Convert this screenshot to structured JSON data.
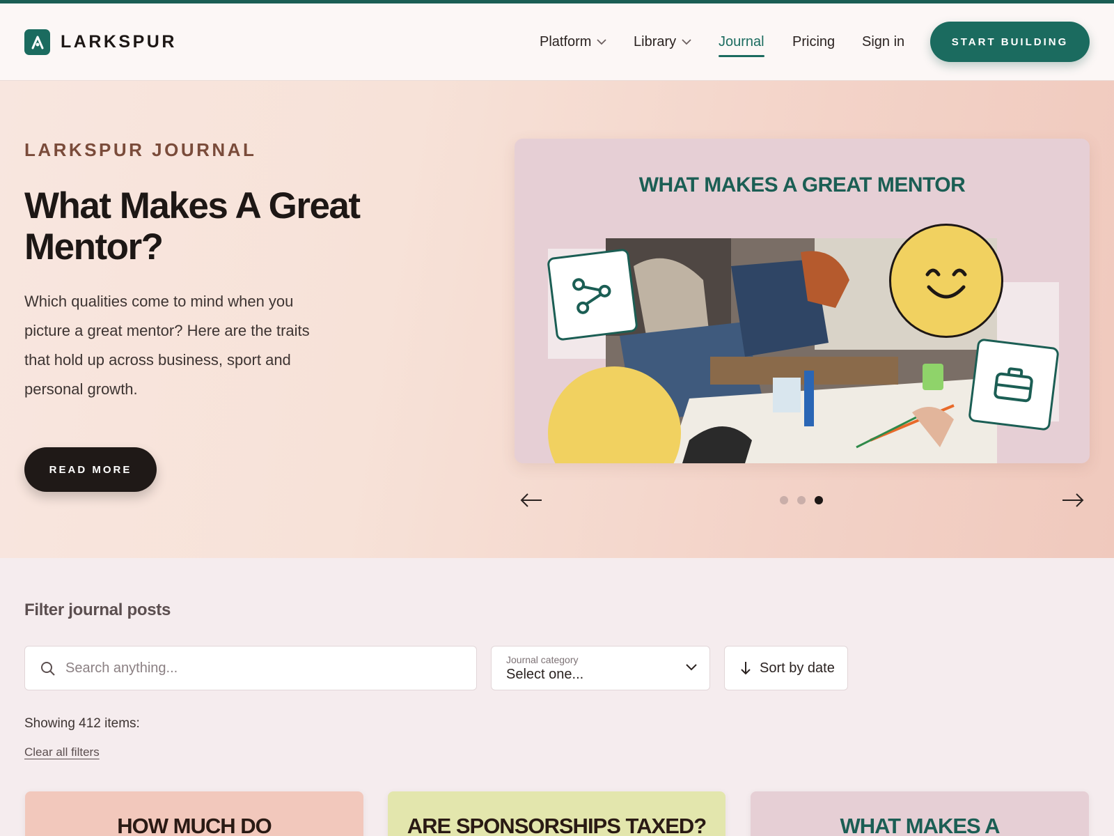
{
  "brand": {
    "name": "LARKSPUR",
    "accent": "#1b6b5f",
    "logo_icon": "larkspur-logo-icon"
  },
  "nav": {
    "items": [
      {
        "label": "Platform",
        "has_dropdown": true
      },
      {
        "label": "Library",
        "has_dropdown": true
      },
      {
        "label": "Journal",
        "active": true
      },
      {
        "label": "Pricing"
      },
      {
        "label": "Sign in"
      }
    ],
    "cta": "START BUILDING"
  },
  "hero": {
    "eyebrow": "LARKSPUR JOURNAL",
    "title": "What Makes A Great Mentor?",
    "description": "Which qualities come to mind when you picture a great mentor? Here are the traits that hold up across business, sport and personal growth.",
    "button": "READ MORE",
    "slide": {
      "title": "WHAT MAKES A GREAT MENTOR",
      "icons": [
        "share-icon",
        "smiley-icon",
        "briefcase-icon"
      ]
    },
    "carousel": {
      "total": 3,
      "active_index": 3,
      "prev_icon": "arrow-left-icon",
      "next_icon": "arrow-right-icon"
    }
  },
  "filters": {
    "heading": "Filter journal posts",
    "search": {
      "placeholder": "Search anything...",
      "value": ""
    },
    "category": {
      "label": "Journal category",
      "value": "Select one..."
    },
    "sort": {
      "label": "Sort by date"
    },
    "count": "Showing 412 items:",
    "clear": "Clear all filters"
  },
  "cards": [
    {
      "title": "HOW MUCH DO",
      "color": "#f2c8bc"
    },
    {
      "title": "ARE SPONSORSHIPS TAXED?",
      "color": "#e3e6ad"
    },
    {
      "title": "WHAT MAKES A",
      "color": "#e6cfd5"
    }
  ]
}
